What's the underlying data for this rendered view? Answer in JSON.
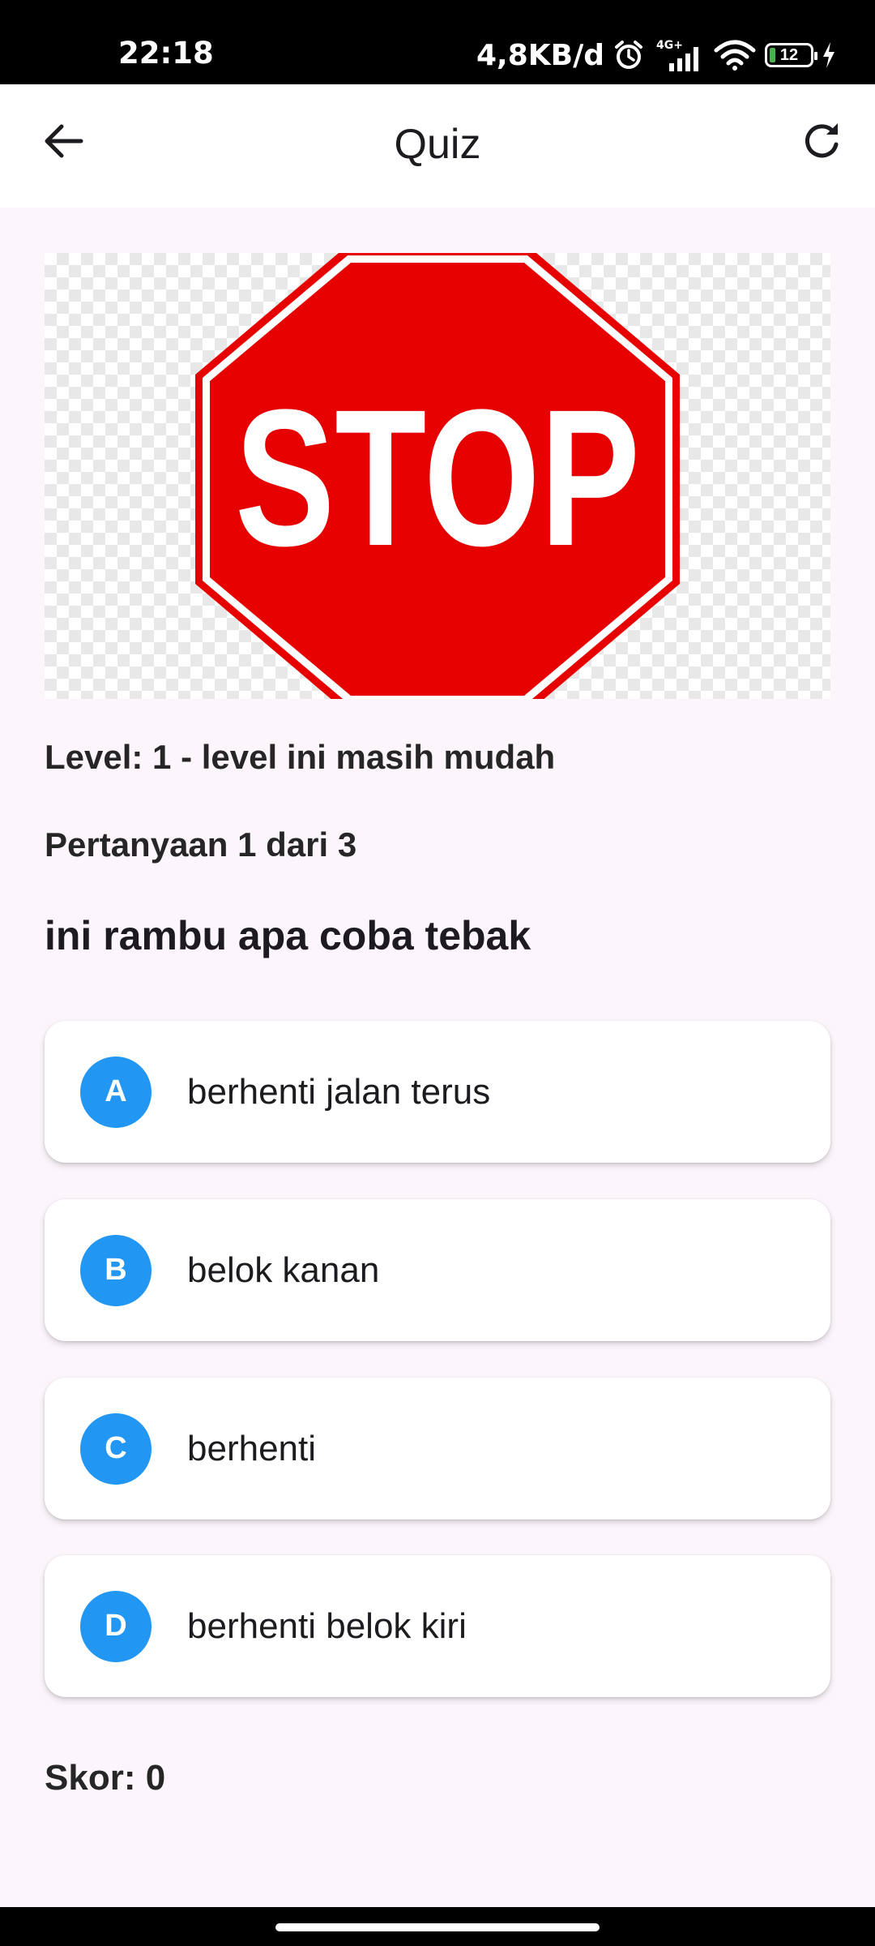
{
  "status_bar": {
    "time": "22:18",
    "net_speed": "4,8KB/d",
    "network_label": "4G+",
    "battery_level": "12"
  },
  "app_bar": {
    "title": "Quiz"
  },
  "quiz": {
    "sign_text": "STOP",
    "sign_color": "#e60000",
    "level": "Level: 1 - level ini masih mudah",
    "progress": "Pertanyaan 1 dari 3",
    "question": "ini rambu apa coba tebak",
    "accent_color": "#2196f3",
    "options": [
      {
        "letter": "A",
        "label": "berhenti jalan terus"
      },
      {
        "letter": "B",
        "label": "belok kanan"
      },
      {
        "letter": "C",
        "label": "berhenti"
      },
      {
        "letter": "D",
        "label": "berhenti belok kiri"
      }
    ],
    "score": "Skor: 0"
  }
}
